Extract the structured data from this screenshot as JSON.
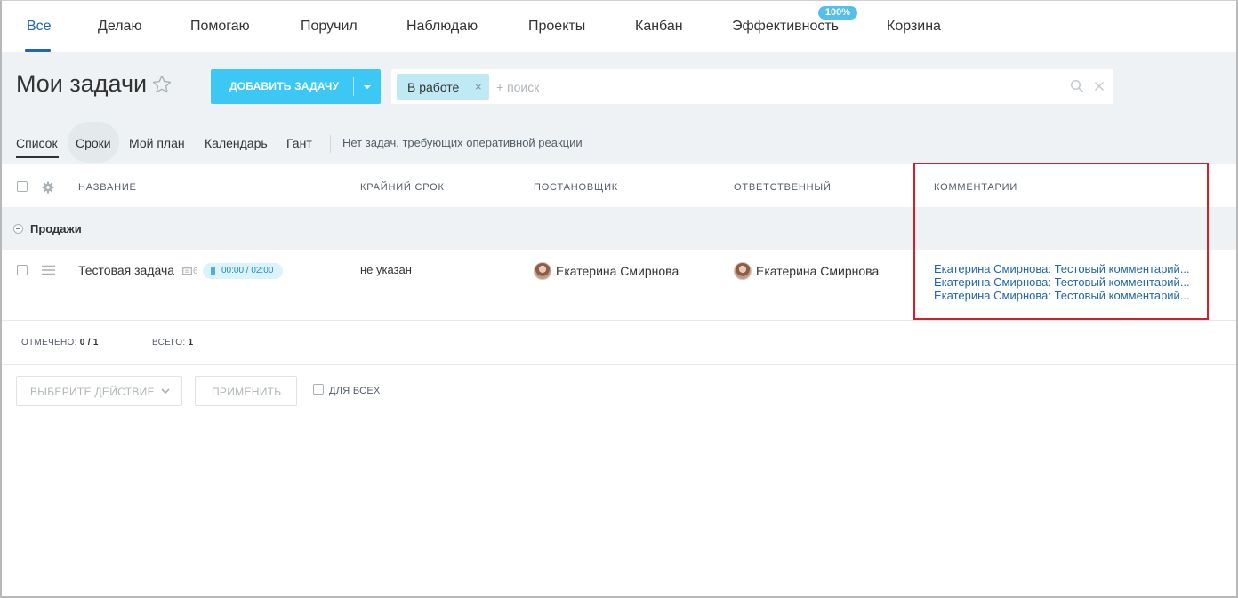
{
  "topnav": {
    "items": [
      {
        "label": "Все",
        "active": true
      },
      {
        "label": "Делаю"
      },
      {
        "label": "Помогаю"
      },
      {
        "label": "Поручил"
      },
      {
        "label": "Наблюдаю"
      },
      {
        "label": "Проекты"
      },
      {
        "label": "Канбан"
      },
      {
        "label": "Эффективность",
        "badge": "100%"
      },
      {
        "label": "Корзина"
      }
    ]
  },
  "header": {
    "title": "Мои задачи",
    "add_button_label": "ДОБАВИТЬ ЗАДАЧУ",
    "filter_tag": "В работе",
    "filter_tag_close": "×",
    "search_placeholder": "+ поиск"
  },
  "views": {
    "items": [
      "Список",
      "Сроки",
      "Мой план",
      "Календарь",
      "Гант"
    ],
    "active": "Список",
    "note": "Нет задач, требующих оперативной реакции"
  },
  "table": {
    "columns": [
      "НАЗВАНИЕ",
      "КРАЙНИЙ СРОК",
      "ПОСТАНОВЩИК",
      "ОТВЕТСТВЕННЫЙ",
      "КОММЕНТАРИИ"
    ],
    "group": "Продажи",
    "rows": [
      {
        "title": "Тестовая задача",
        "comment_count": "6",
        "timer": "00:00 / 02:00",
        "deadline": "не указан",
        "creator": "Екатерина Смирнова",
        "responsible": "Екатерина Смирнова",
        "comments": [
          "Екатерина Смирнова: Тестовый комментарий...",
          "Екатерина Смирнова: Тестовый комментарий...",
          "Екатерина Смирнова: Тестовый комментарий..."
        ]
      }
    ]
  },
  "totals": {
    "selected_label": "ОТМЕЧЕНО:",
    "selected_value": "0 / 1",
    "total_label": "ВСЕГО:",
    "total_value": "1"
  },
  "actions": {
    "select_label": "ВЫБЕРИТЕ ДЕЙСТВИЕ",
    "apply_label": "ПРИМЕНИТЬ",
    "for_all_label": "ДЛЯ ВСЕХ"
  },
  "colors": {
    "accent": "#2067b0",
    "add_button": "#3bc8f5",
    "highlight_box": "#d0202a"
  }
}
